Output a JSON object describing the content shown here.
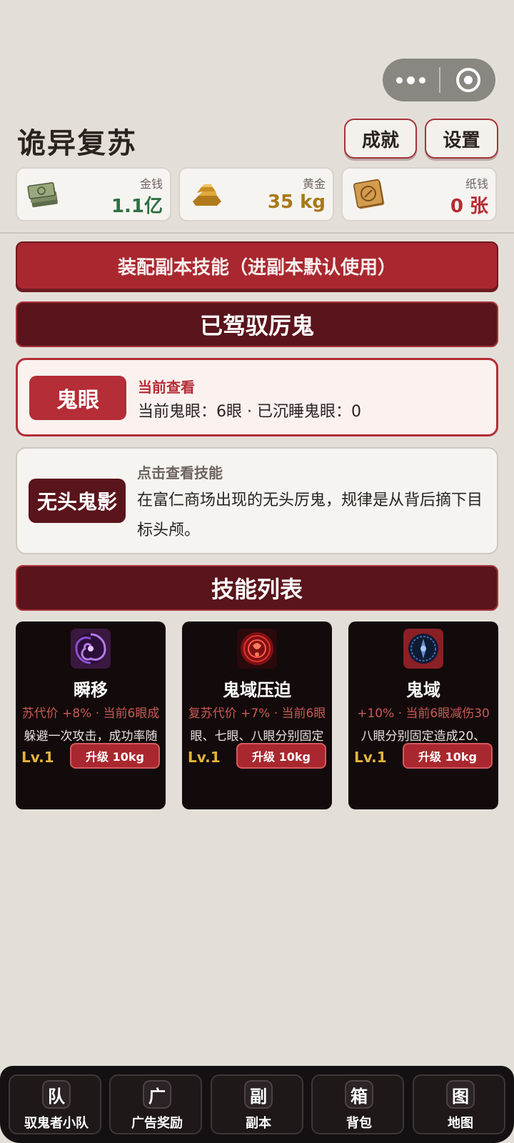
{
  "header": {
    "title": "诡异复苏",
    "achievements_label": "成就",
    "settings_label": "设置"
  },
  "resources": [
    {
      "label": "金钱",
      "value": "1.1亿",
      "icon": "money-icon"
    },
    {
      "label": "黄金",
      "value": "35 kg",
      "icon": "gold-bar-icon"
    },
    {
      "label": "纸钱",
      "value": "0 张",
      "icon": "paper-money-icon"
    }
  ],
  "equip_button": "装配副本技能（进副本默认使用）",
  "tamed_section": {
    "title": "已驾驭厉鬼",
    "ghosts": [
      {
        "name": "鬼眼",
        "hint": "当前查看",
        "desc": "当前鬼眼：6眼 · 已沉睡鬼眼：0"
      },
      {
        "name": "无头鬼影",
        "hint": "点击查看技能",
        "desc": "在富仁商场出现的无头厉鬼，规律是从背后摘下目标头颅。"
      }
    ]
  },
  "skills_section": {
    "title": "技能列表",
    "skills": [
      {
        "name": "瞬移",
        "line1": "苏代价 +8% · 当前6眼成",
        "line2": "躲避一次攻击，成功率随",
        "level": "Lv.1",
        "upgrade": "升级 10kg"
      },
      {
        "name": "鬼域压迫",
        "line1": "复苏代价 +7% · 当前6眼",
        "line2": "眼、七眼、八眼分别固定",
        "level": "Lv.1",
        "upgrade": "升级 10kg"
      },
      {
        "name": "鬼域",
        "line1": "+10% · 当前6眼减伤30",
        "line2": "八眼分别固定造成20、",
        "level": "Lv.1",
        "upgrade": "升级 10kg"
      }
    ]
  },
  "bottom_nav": [
    {
      "glyph": "队",
      "label": "驭鬼者小队"
    },
    {
      "glyph": "广",
      "label": "广告奖励"
    },
    {
      "glyph": "副",
      "label": "副本"
    },
    {
      "glyph": "箱",
      "label": "背包"
    },
    {
      "glyph": "图",
      "label": "地图"
    }
  ],
  "colors": {
    "accent_red": "#a9282f",
    "dark_maroon": "#5a141b",
    "money_green": "#2f6f45",
    "gold": "#a87818",
    "background": "#e3dfd8"
  }
}
